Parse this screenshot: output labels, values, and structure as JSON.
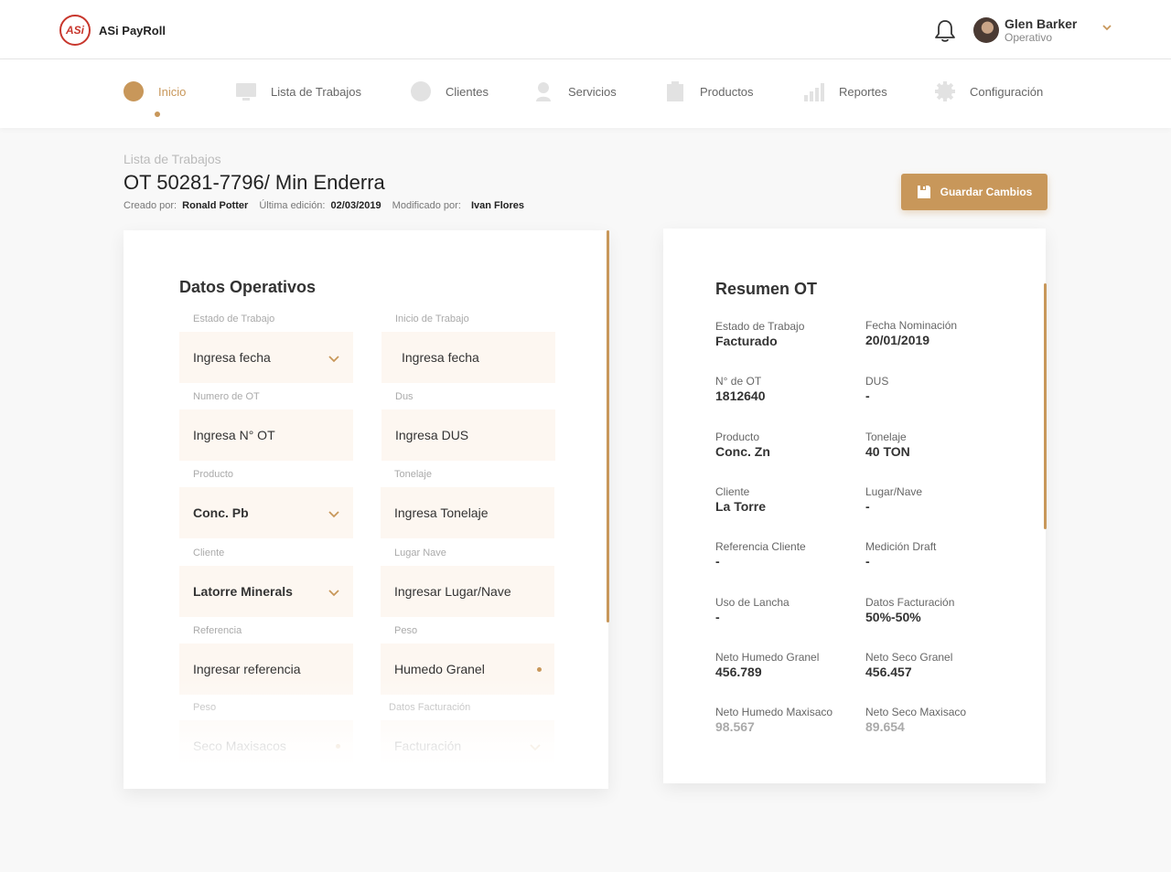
{
  "app": {
    "logo_text": "ASi",
    "name": "ASi PayRoll"
  },
  "user": {
    "name": "Glen Barker",
    "role": "Operativo"
  },
  "nav": {
    "items": [
      {
        "label": "Inicio",
        "icon": "home-circle-icon",
        "active": true
      },
      {
        "label": "Lista de Trabajos",
        "icon": "monitor-icon"
      },
      {
        "label": "Clientes",
        "icon": "client-circle-icon"
      },
      {
        "label": "Servicios",
        "icon": "person-icon"
      },
      {
        "label": "Productos",
        "icon": "clipboard-icon"
      },
      {
        "label": "Reportes",
        "icon": "bar-chart-icon"
      },
      {
        "label": "Configuración",
        "icon": "gear-icon"
      }
    ]
  },
  "header": {
    "breadcrumb": "Lista de Trabajos",
    "title": "OT 50281-7796/ Min Enderra",
    "created_by_label": "Creado por:",
    "created_by": "Ronald Potter",
    "last_edit_label": "Última edición:",
    "last_edit": "02/03/2019",
    "modified_by_label": "Modificado por:",
    "modified_by": "Ivan Flores",
    "save_button": "Guardar Cambios"
  },
  "form": {
    "title": "Datos Operativos",
    "fields": [
      {
        "label": "Estado de Trabajo",
        "value": "Ingresa fecha",
        "control": "select"
      },
      {
        "label": "Inicio de Trabajo",
        "value": "Ingresa fecha",
        "control": "input"
      },
      {
        "label": "Numero de OT",
        "value": "Ingresa N° OT",
        "control": "input"
      },
      {
        "label": "Dus",
        "value": "Ingresa DUS",
        "control": "input"
      },
      {
        "label": "Producto",
        "value": "Conc. Pb",
        "control": "select"
      },
      {
        "label": "Tonelaje",
        "value": "Ingresa Tonelaje",
        "control": "input"
      },
      {
        "label": "Cliente",
        "value": "Latorre Minerals",
        "control": "select"
      },
      {
        "label": "Lugar Nave",
        "value": "Ingresar Lugar/Nave",
        "control": "input"
      },
      {
        "label": "Referencia",
        "value": "Ingresar referencia",
        "control": "input"
      },
      {
        "label": "Peso",
        "value": "Humedo Granel",
        "control": "radio"
      },
      {
        "label": "Peso",
        "value": "Seco Maxisacos",
        "control": "radio"
      },
      {
        "label": "Datos Facturación",
        "value": "Facturación",
        "control": "select"
      }
    ]
  },
  "summary": {
    "title": "Resumen OT",
    "items": [
      {
        "label": "Estado de Trabajo",
        "value": "Facturado"
      },
      {
        "label": "Fecha Nominación",
        "value": "20/01/2019"
      },
      {
        "label": "N° de OT",
        "value": "1812640"
      },
      {
        "label": "DUS",
        "value": "-"
      },
      {
        "label": "Producto",
        "value": "Conc. Zn"
      },
      {
        "label": "Tonelaje",
        "value": "40 TON"
      },
      {
        "label": "Cliente",
        "value": "La Torre"
      },
      {
        "label": "Lugar/Nave",
        "value": "-"
      },
      {
        "label": "Referencia Cliente",
        "value": "-"
      },
      {
        "label": "Medición Draft",
        "value": "-"
      },
      {
        "label": "Uso de Lancha",
        "value": "-"
      },
      {
        "label": "Datos  Facturación",
        "value": "50%-50%"
      },
      {
        "label": "Neto Humedo Granel",
        "value": "456.789"
      },
      {
        "label": "Neto Seco Granel",
        "value": "456.457"
      },
      {
        "label": "Neto Humedo Maxisaco",
        "value": "98.567"
      },
      {
        "label": "Neto Seco Maxisaco",
        "value": "89.654"
      }
    ]
  },
  "colors": {
    "accent": "#c8975a",
    "field_bg": "#fdf7f1",
    "logo_red": "#c8372d"
  }
}
